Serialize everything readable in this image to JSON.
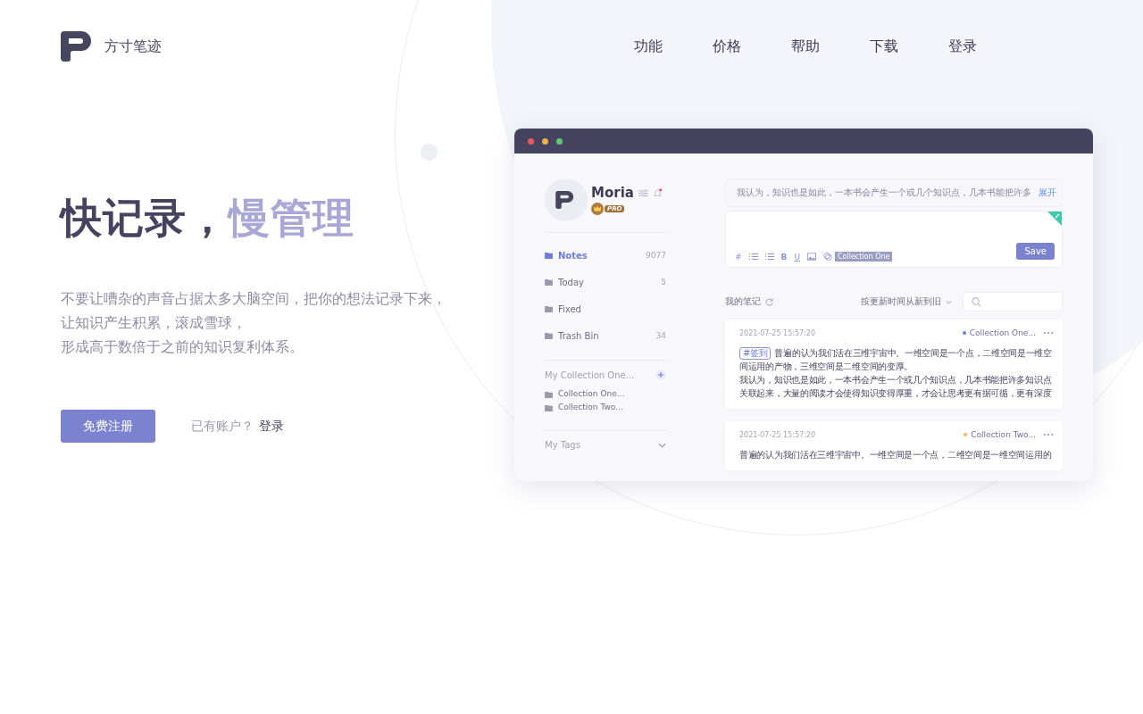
{
  "brand": {
    "name": "方寸笔迹"
  },
  "nav": [
    {
      "label": "功能"
    },
    {
      "label": "价格"
    },
    {
      "label": "帮助"
    },
    {
      "label": "下载"
    },
    {
      "label": "登录"
    }
  ],
  "hero": {
    "headline": "快记录，",
    "headline_accent": "慢管理",
    "description": [
      "不要让嘈杂的声音占据太多大脑空间，把你的想法记录下来，",
      "让知识产生积累，滚成雪球，",
      "形成高于数倍于之前的知识复利体系。"
    ],
    "signup_button": "免费注册",
    "account_prompt": "已有账户？",
    "login_link": "登录"
  },
  "app_window": {
    "user": {
      "name": "Moria",
      "badge": "PRO"
    },
    "nav_items": [
      {
        "label": "Notes",
        "count": "9077",
        "selected": true
      },
      {
        "label": "Today",
        "count": "5",
        "selected": false
      },
      {
        "label": "Fixed",
        "selected": false
      },
      {
        "label": "Trash Bin",
        "count": "34",
        "selected": false
      }
    ],
    "collections": {
      "title": "My Collection One...",
      "items": [
        "Collection One...",
        "Collection Two..."
      ]
    },
    "tags": {
      "title": "My Tags"
    },
    "editor": {
      "preview": "我认为，知识也是如此，一本书会产生一个或几个知识点，几本书能把许多",
      "expand_link": "展开",
      "toolbar": [
        "#",
        "B",
        "U"
      ],
      "collection_tag": "Collection One",
      "save_button": "Save"
    },
    "notes_header": {
      "title": "我的笔记",
      "sort": "按更新时间从新到旧"
    },
    "notes": [
      {
        "date": "2021-07-25 15:57:20",
        "collection": "Collection One...",
        "color": "#6f7bd8",
        "tag": "#签到",
        "paragraphs": [
          "普遍的认为我们活在三维宇宙中。一维空间是一个点，二维空间是一维空间运用的产物，三维空间是二维空间的变厚。",
          "我认为，知识也是如此，一本书会产生一个或几个知识点，几本书能把许多知识点关联起来，大量的阅读才会使得知识变得厚重，才会让思考更有据可循，更有深度"
        ]
      },
      {
        "date": "2021-07-25 15:57:20",
        "collection": "Collection Two...",
        "color": "#f2b84b",
        "paragraphs": [
          "普遍的认为我们活在三维宇宙中。一维空间是一个点，二维空间是一维空间运用的"
        ]
      }
    ]
  }
}
